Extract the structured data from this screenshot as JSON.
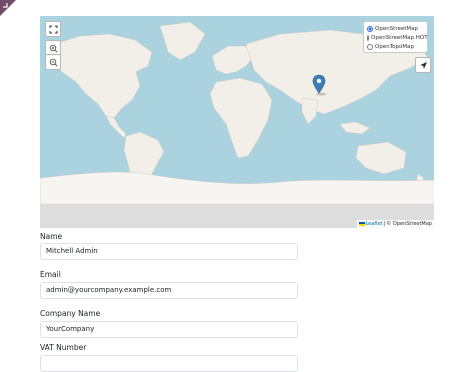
{
  "map": {
    "layers": [
      "OpenStreetMap",
      "OpenStreetMap.HOT",
      "OpenTopoMap"
    ],
    "selected_layer": "OpenStreetMap",
    "attribution": {
      "leaflet": "Leaflet",
      "separator": "|",
      "osm": "© OpenStreetMap"
    },
    "icons": {
      "fullscreen": "fullscreen-icon",
      "zoom_in": "zoom-in-icon",
      "zoom_out": "zoom-out-icon",
      "locate": "locate-arrow-icon",
      "marker": "map-marker-icon"
    }
  },
  "form": {
    "name_label": "Name",
    "name_value": "Mitchell Admin",
    "email_label": "Email",
    "email_value": "admin@yourcompany.example.com",
    "company_label": "Company Name",
    "company_value": "YourCompany",
    "vat_label": "VAT Number",
    "vat_value": ""
  },
  "colors": {
    "water": "#aad3df",
    "land": "#f2efe9",
    "marker": "#3c7eb8",
    "brand": "#714B67"
  }
}
